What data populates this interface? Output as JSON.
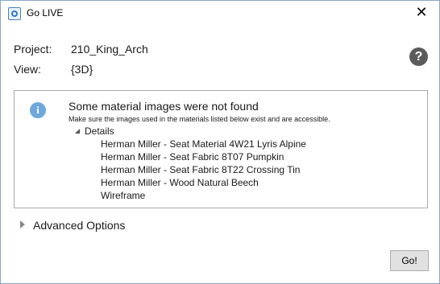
{
  "window": {
    "title": "Go LIVE",
    "close_glyph": "✕"
  },
  "project": {
    "label": "Project:",
    "value": "210_King_Arch"
  },
  "view": {
    "label": "View:",
    "value": "{3D}"
  },
  "help": {
    "glyph": "?"
  },
  "message": {
    "icon_glyph": "i",
    "title": "Some material images were not found",
    "subtitle": "Make sure the images used in the materials listed below exist and are accessible.",
    "details_label": "Details",
    "items": [
      "Herman Miller - Seat Material 4W21 Lyris Alpine",
      "Herman Miller - Seat Fabric 8T07 Pumpkin",
      "Herman Miller - Seat Fabric 8T22 Crossing Tin",
      "Herman Miller - Wood Natural Beech",
      "Wireframe"
    ]
  },
  "advanced": {
    "label": "Advanced Options"
  },
  "actions": {
    "go_label": "Go!"
  }
}
